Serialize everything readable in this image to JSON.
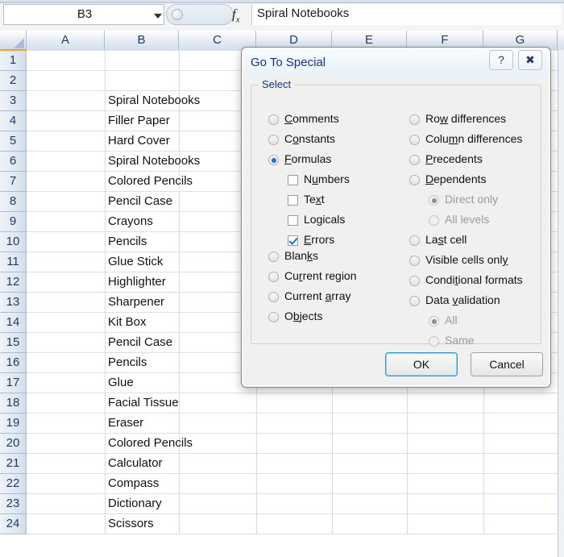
{
  "formula_bar": {
    "name_box_value": "B3",
    "fx_label": "fx",
    "formula_value": "Spiral Notebooks",
    "dropdown_icon": "chevron-down-icon"
  },
  "sheet": {
    "column_headers": [
      "A",
      "B",
      "C",
      "D",
      "E",
      "F",
      "G"
    ],
    "row_headers": [
      "1",
      "2",
      "3",
      "4",
      "5",
      "6",
      "7",
      "8",
      "9",
      "10",
      "11",
      "12",
      "13",
      "14",
      "15",
      "16",
      "17",
      "18",
      "19",
      "20",
      "21",
      "22",
      "23",
      "24"
    ],
    "column_b_values": [
      "",
      "",
      "Spiral Notebooks",
      "Filler Paper",
      "Hard Cover",
      "Spiral Notebooks",
      "Colored Pencils",
      "Pencil Case",
      "Crayons",
      "Pencils",
      "Glue Stick",
      "Highlighter",
      "Sharpener",
      "Kit Box",
      "Pencil Case",
      "Pencils",
      "Glue",
      "Facial Tissue",
      "Eraser",
      "Colored Pencils",
      "Calculator",
      "Compass",
      "Dictionary",
      "Scissors"
    ]
  },
  "dialog": {
    "title": "Go To Special",
    "help_icon": "question-mark-icon",
    "close_icon": "close-icon",
    "group_label": "Select",
    "left_options": [
      {
        "label": "Comments",
        "accel": "C",
        "selected": false
      },
      {
        "label": "Constants",
        "accel": "o",
        "selected": false
      },
      {
        "label": "Formulas",
        "accel": "F",
        "selected": true
      },
      {
        "label": "Blanks",
        "accel": "k",
        "selected": false
      },
      {
        "label": "Current region",
        "accel": "r",
        "selected": false
      },
      {
        "label": "Current array",
        "accel": "a",
        "selected": false
      },
      {
        "label": "Objects",
        "accel": "b",
        "selected": false
      }
    ],
    "formula_subtypes": [
      {
        "label": "Numbers",
        "accel": "u",
        "checked": false
      },
      {
        "label": "Text",
        "accel": "x",
        "checked": false
      },
      {
        "label": "Logicals",
        "accel": "g",
        "checked": false
      },
      {
        "label": "Errors",
        "accel": "E",
        "checked": true
      }
    ],
    "right_options": [
      {
        "label": "Row differences",
        "accel": "w",
        "selected": false
      },
      {
        "label": "Column differences",
        "accel": "m",
        "selected": false
      },
      {
        "label": "Precedents",
        "accel": "P",
        "selected": false
      },
      {
        "label": "Dependents",
        "accel": "D",
        "selected": false
      },
      {
        "label": "Last cell",
        "accel": "s",
        "selected": false
      },
      {
        "label": "Visible cells only",
        "accel": "y",
        "selected": false
      },
      {
        "label": "Conditional formats",
        "accel": "t",
        "selected": false
      },
      {
        "label": "Data validation",
        "accel": "v",
        "selected": false
      }
    ],
    "dependents_subtypes": [
      {
        "label": "Direct only",
        "selected": true,
        "disabled": true
      },
      {
        "label": "All levels",
        "selected": false,
        "disabled": true
      }
    ],
    "validation_subtypes": [
      {
        "label": "All",
        "selected": true,
        "disabled": true
      },
      {
        "label": "Same",
        "selected": false,
        "disabled": true
      }
    ],
    "ok_label": "OK",
    "cancel_label": "Cancel"
  },
  "colors": {
    "accent_blue": "#1f6fc4",
    "title_blue": "#15337a",
    "default_button_border": "#2e9bd6",
    "header_text": "#1f3a5f"
  }
}
